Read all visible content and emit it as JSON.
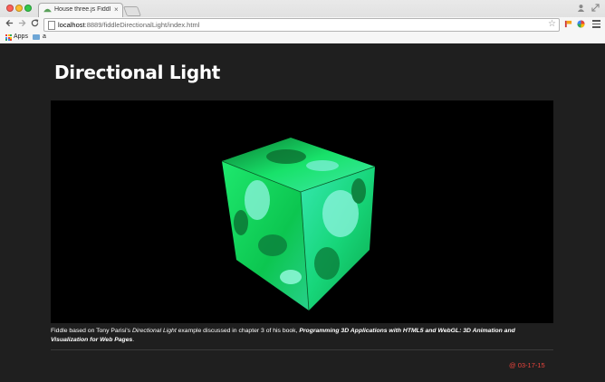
{
  "browser": {
    "tab_title": "House three.js Fiddle – fi",
    "tab_close": "×",
    "url_host": "localhost",
    "url_rest": ":8889/fiddleDirectionalLight/index.html",
    "bookmarks": [
      {
        "label": "Apps"
      },
      {
        "label": "a"
      }
    ]
  },
  "page": {
    "title": "Directional Light",
    "caption": {
      "prefix": "Fiddle based on Tony Parisi's ",
      "example": "Directional Light",
      "middle": " example discussed in chapter 3 of his book, ",
      "book": "Programming 3D Applications with HTML5 and WebGL: 3D Animation and Visualization for Web Pages",
      "suffix": "."
    },
    "date": "@ 03-17-15"
  },
  "colors": {
    "accent_date": "#e8443c",
    "page_bg": "#1f1f1f",
    "cube_green": "#0ed85a"
  }
}
